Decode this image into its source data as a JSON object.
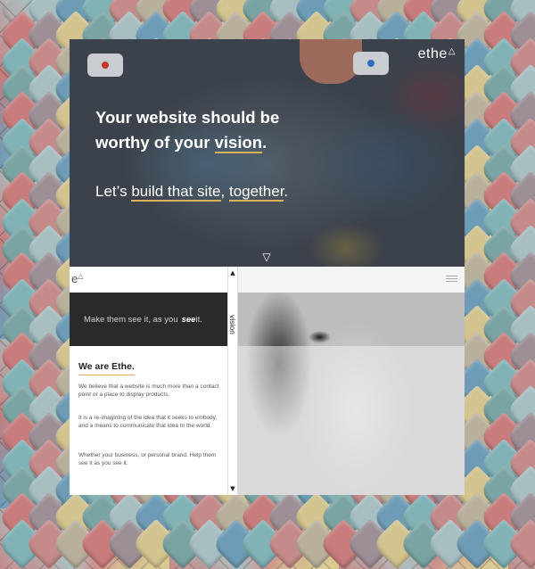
{
  "hero": {
    "logo": "ethe",
    "logo_mark": "△",
    "headline_line1": "Your website should be",
    "headline_line2_pre": "worthy of your ",
    "headline_line2_hl": "vision",
    "headline_line2_post": ".",
    "sub_pre": "Let’s ",
    "sub_hl1": "build that site",
    "sub_mid": ", ",
    "sub_hl2": "together",
    "sub_post": ".",
    "scroll_icon": "▽"
  },
  "left_panel": {
    "logo": "e",
    "logo_mark": "△",
    "band_pre": "Make them see it, as you ",
    "band_see": "see",
    "band_post": "it.",
    "title": "We are Ethe.",
    "para1": "We believe that a website is much more than a contact point or a place to display products.",
    "para2": "It is a re-imagining of the idea that it seeks to embody, and a means to communicate that idea to the world.",
    "para3": "Whether your business, or personal brand. Help them see it as you see it."
  },
  "scroll_column": {
    "up_arrow": "▲",
    "label": "vision",
    "down_arrow": "▼"
  },
  "colors": {
    "accent": "#d9b25a",
    "dark_band": "#2a2a2a"
  }
}
